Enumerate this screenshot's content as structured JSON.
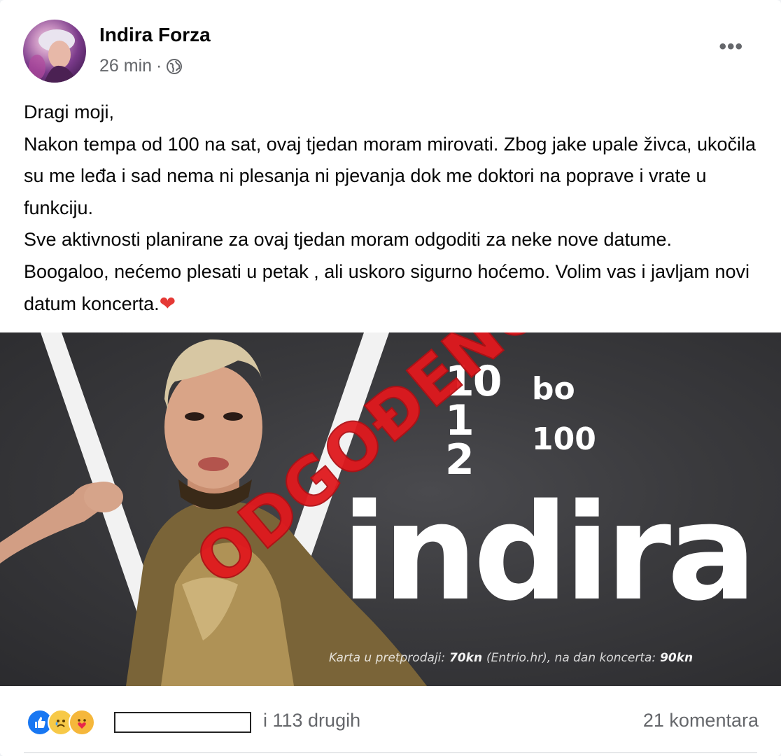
{
  "post": {
    "author": "Indira Forza",
    "time": "26 min",
    "separator": "·",
    "audience_icon": "globe-icon",
    "more_icon": "more-options-icon",
    "more_label": "•••",
    "text": {
      "line1": "Dragi moji,",
      "line2": "Nakon tempa od 100 na sat, ovaj tjedan moram mirovati. Zbog jake upale živca, ukočila su me leđa i sad nema ni plesanja ni pjevanja dok me doktori na poprave i vrate u funkciju.",
      "line3": "Sve aktivnosti planirane za ovaj tjedan moram  odgoditi za neke nove datume. Boogaloo, nećemo plesati u petak , ali uskoro sigurno hoćemo. Volim vas i javljam novi datum koncerta.",
      "heart": "❤"
    }
  },
  "poster": {
    "dates": [
      "10",
      "1",
      "2"
    ],
    "venue_top": "bo",
    "venue_bottom": "100",
    "brand": "indira",
    "stamp": "ODGOĐENO",
    "price_label": "Karta u pretprodaji:",
    "price_presale": "70kn",
    "price_presale_note": "(Entrio.hr), na dan koncerta:",
    "price_door": "90kn"
  },
  "footer": {
    "reactions": [
      "like-icon",
      "sad-icon",
      "care-icon"
    ],
    "others": "i 113 drugih",
    "comments": "21 komentara"
  },
  "colors": {
    "accent": "#1877f2",
    "stamp_red": "#e0191e",
    "secondary_text": "#65676b"
  }
}
